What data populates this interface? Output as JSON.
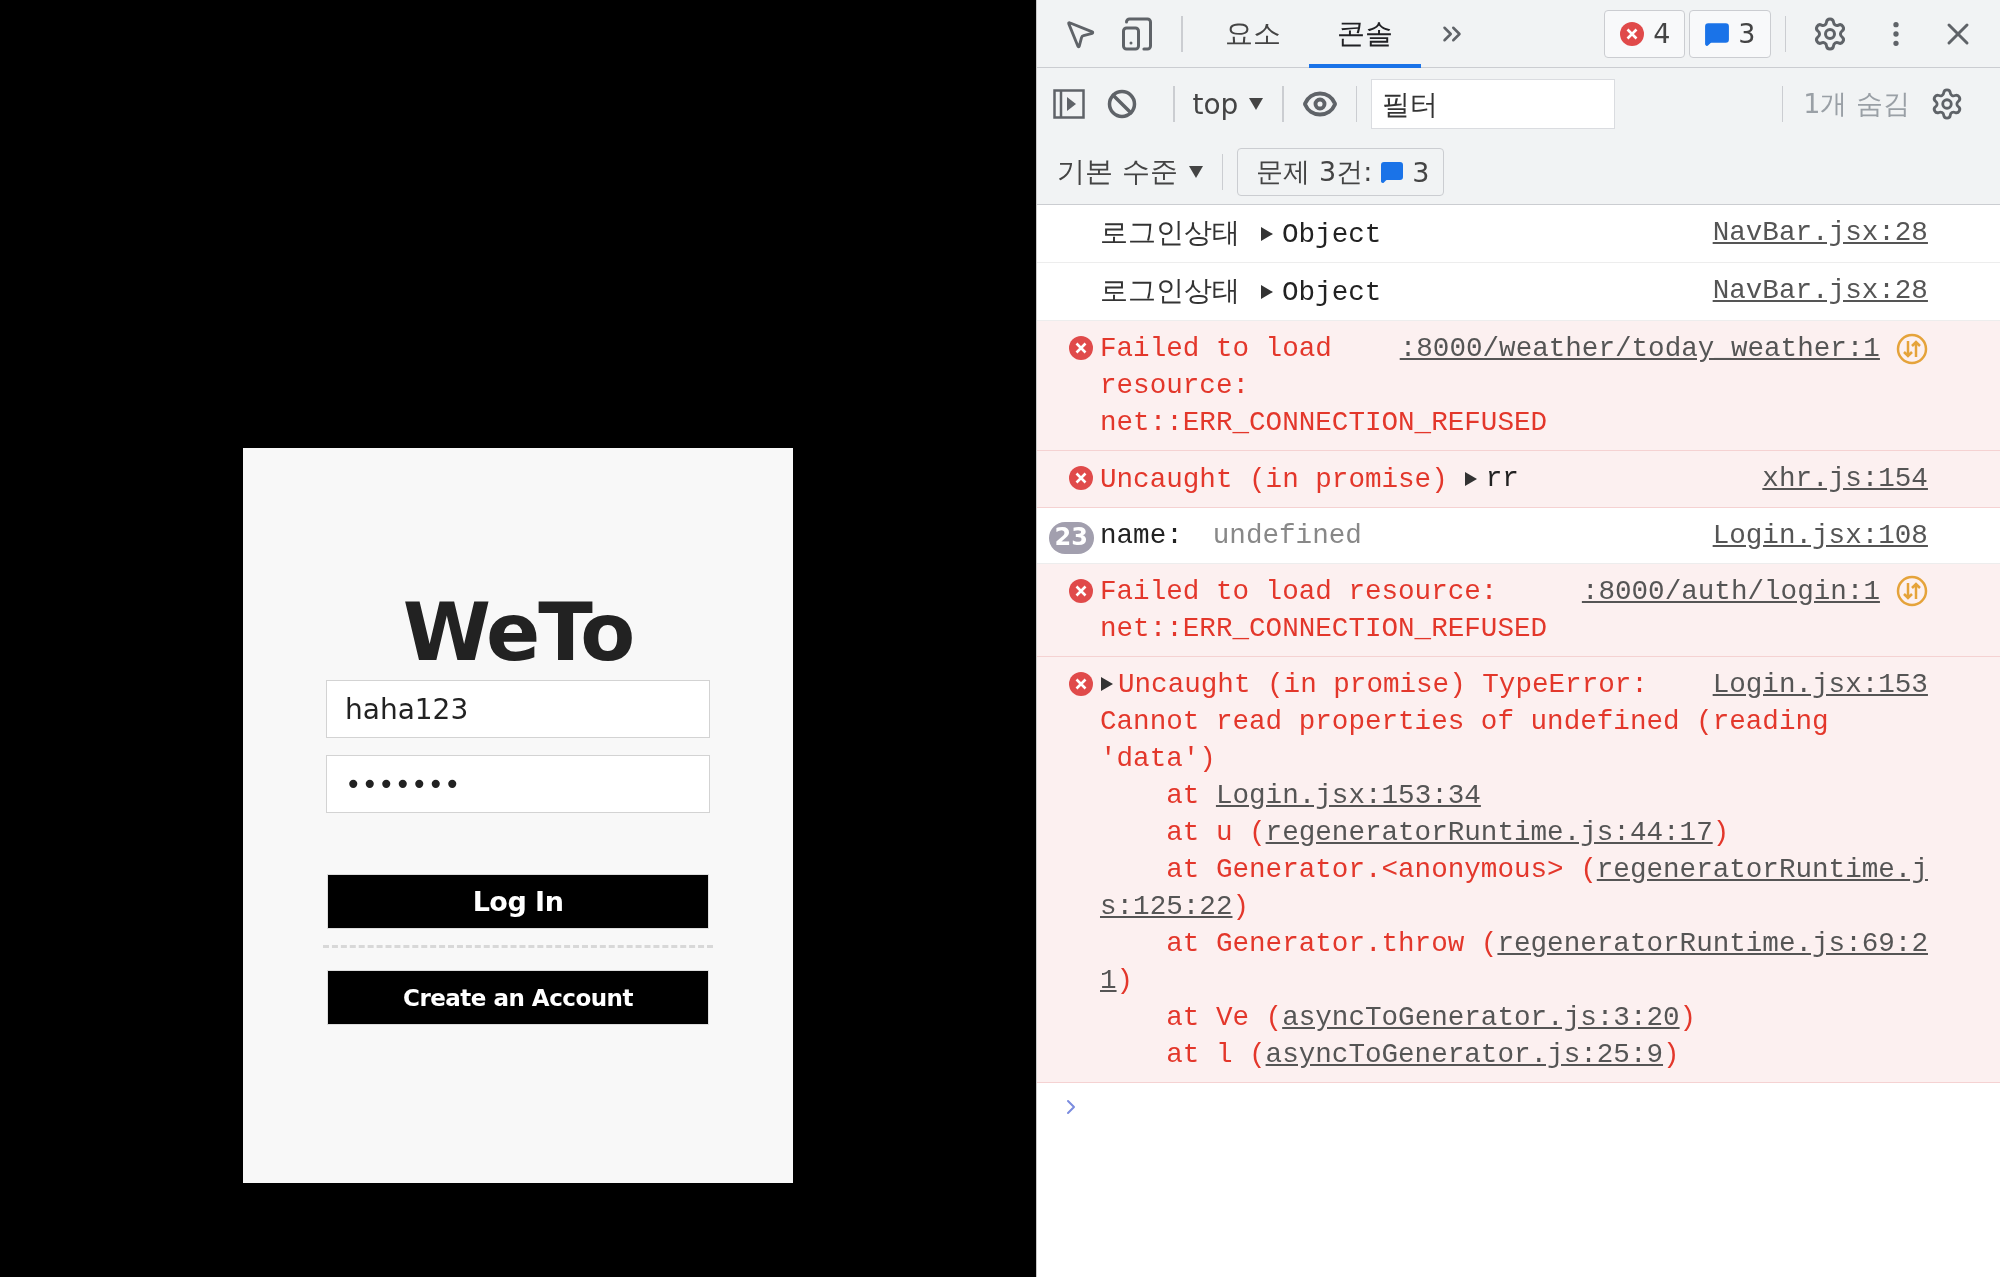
{
  "login": {
    "title": "WeTo",
    "username": {
      "value": "haha123"
    },
    "password": {
      "value": "•••••••"
    },
    "buttons": [
      {
        "label": "Log In",
        "kind": "primary"
      },
      {
        "label": "Create an Account",
        "kind": "secondary"
      }
    ]
  },
  "devtools": {
    "tabs": [
      {
        "label": "요소",
        "selected": false
      },
      {
        "label": "콘솔",
        "selected": true
      }
    ],
    "error_count": "4",
    "issue_count": "3",
    "console_toolbar": {
      "context": "top",
      "filter": {
        "placeholder": "필터"
      },
      "hidden": "1개 숨김",
      "level": "기본 수준",
      "issues": {
        "label": "문제 3건:",
        "count": "3"
      }
    },
    "messages": [
      {
        "kind": "log",
        "label": "로그인상태",
        "object": "Object",
        "source": "NavBar.jsx:28"
      },
      {
        "kind": "log",
        "label": "로그인상태",
        "object": "Object",
        "source": "NavBar.jsx:28"
      },
      {
        "kind": "error",
        "lines": [
          "Failed to load",
          "resource:",
          "net::ERR_CONNECTION_REFUSED"
        ],
        "source": ":8000/weather/today_weather:1",
        "network": true
      },
      {
        "kind": "error",
        "lines": [
          "Uncaught (in promise)"
        ],
        "object": "rr",
        "source": "xhr.js:154"
      },
      {
        "kind": "log",
        "count": "23",
        "label": "name:",
        "value": "undefined",
        "source": "Login.jsx:108"
      },
      {
        "kind": "error",
        "lines": [
          "Failed to load resource:",
          "net::ERR_CONNECTION_REFUSED"
        ],
        "source": ":8000/auth/login:1",
        "network": true
      },
      {
        "kind": "error",
        "expandable": true,
        "lines": [
          "Uncaught (in promise) TypeError:",
          "Cannot read properties of undefined (reading",
          "'data')"
        ],
        "source": "Login.jsx:153",
        "stack": [
          {
            "text": "at ",
            "link": "Login.jsx:153:34"
          },
          {
            "text": "at u (",
            "link": "regeneratorRuntime.js:44:17",
            "after": ")"
          },
          {
            "text": "at Generator.<anonymous> (",
            "link": "regeneratorRuntime.j",
            "wrap": {
              "link": "s:125:22",
              "after": ")"
            }
          },
          {
            "text": "at Generator.throw (",
            "link": "regeneratorRuntime.js:69:2",
            "wrap": {
              "link": "1",
              "after": ")"
            }
          },
          {
            "text": "at Ve (",
            "link": "asyncToGenerator.js:3:20",
            "after": ")"
          },
          {
            "text": "at l (",
            "link": "asyncToGenerator.js:25:9",
            "after": ")"
          }
        ]
      }
    ]
  }
}
